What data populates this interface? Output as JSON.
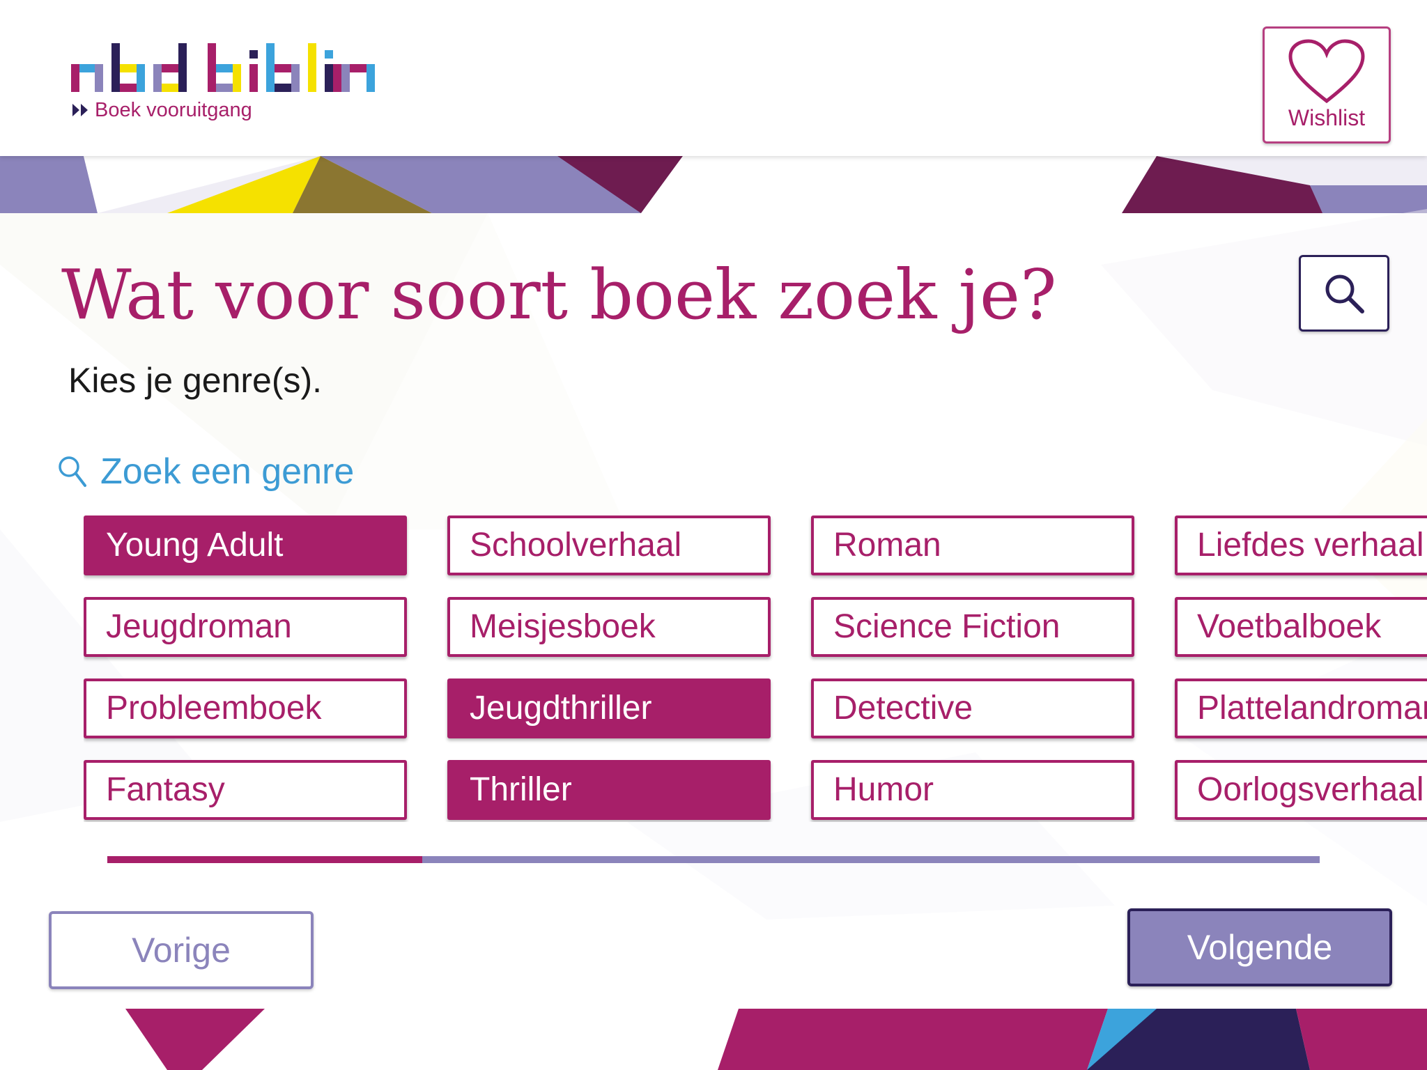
{
  "header": {
    "logo_text": "nbd biblion",
    "tagline": "Boek vooruitgang",
    "wishlist_label": "Wishlist"
  },
  "main": {
    "title": "Wat voor soort boek zoek je?",
    "subtitle": "Kies je genre(s).",
    "genre_search_placeholder": "Zoek een genre",
    "genres": [
      {
        "label": "Young Adult",
        "selected": true
      },
      {
        "label": "Schoolverhaal",
        "selected": false
      },
      {
        "label": "Roman",
        "selected": false
      },
      {
        "label": "Liefdes verhaal",
        "selected": false
      },
      {
        "label": "Jeugdroman",
        "selected": false
      },
      {
        "label": "Meisjesboek",
        "selected": false
      },
      {
        "label": "Science Fiction",
        "selected": false
      },
      {
        "label": "Voetbalboek",
        "selected": false
      },
      {
        "label": "Probleemboek",
        "selected": false
      },
      {
        "label": "Jeugdthriller",
        "selected": true
      },
      {
        "label": "Detective",
        "selected": false
      },
      {
        "label": "Plattelandroman",
        "selected": false
      },
      {
        "label": "Fantasy",
        "selected": false
      },
      {
        "label": "Thriller",
        "selected": true
      },
      {
        "label": "Humor",
        "selected": false
      },
      {
        "label": "Oorlogsverhaal",
        "selected": false
      }
    ],
    "progress_fraction": 0.26
  },
  "navigation": {
    "prev_label": "Vorige",
    "next_label": "Volgende"
  },
  "colors": {
    "brand_magenta": "#a71f69",
    "lavender": "#8b84bb",
    "navy": "#2b2058",
    "search_blue": "#3c9bd4",
    "yellow": "#f5e100",
    "sky_blue": "#3ca3dc"
  },
  "icons": {
    "wishlist": "heart-icon",
    "search": "magnifier-icon",
    "genre_search": "magnifier-icon",
    "tagline": "double-chevron-right-icon"
  }
}
